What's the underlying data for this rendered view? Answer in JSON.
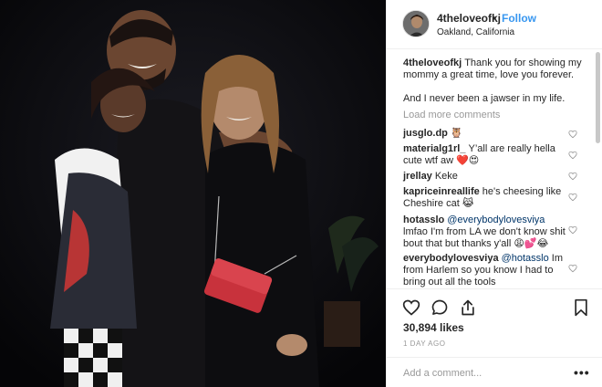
{
  "header": {
    "username": "4theloveofkj",
    "separator": "•",
    "follow_label": "Follow",
    "location": "Oakland, California"
  },
  "caption": {
    "username": "4theloveofkj",
    "text": "Thank you for showing my mommy a great time, love you forever.",
    "text_2": "And I never been a jawser in my life."
  },
  "load_more_label": "Load more comments",
  "comments": [
    {
      "username": "jusglo.dp",
      "text": "🦉"
    },
    {
      "username": "materialg1rl_",
      "text": "Y’all are really hella cute wtf aw ❤️😍"
    },
    {
      "username": "jrellay",
      "text": "Keke"
    },
    {
      "username": "kapriceinreallife",
      "text": "he's cheesing like Cheshire cat 😹"
    },
    {
      "username": "hotasslo",
      "mention": "@everybodylovesviya",
      "text": "lmfao I'm from LA we don't know shit bout that but thanks y'all 😩💕😂"
    },
    {
      "username": "everybodylovesviya",
      "mention": "@hotasslo",
      "text": "Im from Harlem so you know I had to bring out all the tools"
    }
  ],
  "icons": {
    "like": "heart-icon",
    "comment": "comment-bubble-icon",
    "share": "share-icon",
    "save": "bookmark-icon",
    "comment_like": "heart-icon",
    "options": "more-options-icon"
  },
  "likes": "30,894 likes",
  "timestamp": "1 DAY AGO",
  "add_comment": {
    "placeholder": "Add a comment...",
    "value": ""
  },
  "options_label": "•••",
  "colors": {
    "link": "#3897f0",
    "text": "#262626",
    "muted": "#999999",
    "border": "#efefef"
  }
}
